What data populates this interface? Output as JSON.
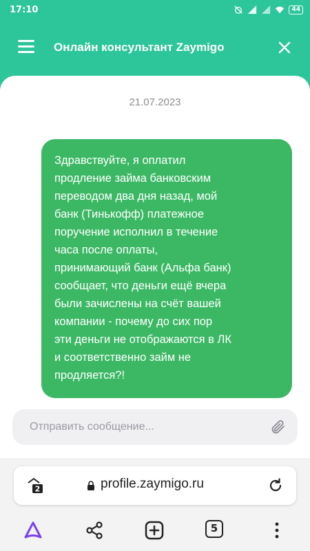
{
  "status_bar": {
    "time": "17:10",
    "battery": "44"
  },
  "header": {
    "title": "Онлайн консультант Zaymigo"
  },
  "chat": {
    "date": "21.07.2023",
    "message_lines": [
      "Здравствуйте, я оплатил",
      "продление займа банковским",
      "переводом два дня назад, мой",
      "банк (Тинькофф) платежное",
      "поручение исполнил в течение",
      "часа после оплаты,",
      "принимающий банк (Альфа банк)",
      "сообщает, что деньги ещё вчера",
      "были зачислены на счёт вашей",
      "компании - почему до сих пор",
      "эти деньги не отображаются в ЛК",
      "и соответственно займ не",
      "продляется?!"
    ],
    "composer_placeholder": "Отправить сообщение..."
  },
  "browser": {
    "url": "profile.zaymigo.ru",
    "private_tabs_count": "2",
    "tabs_count": "5"
  },
  "colors": {
    "brand": "#2dc59a",
    "bubble": "#3cb865",
    "alice_accent": "#7b3ff2"
  }
}
